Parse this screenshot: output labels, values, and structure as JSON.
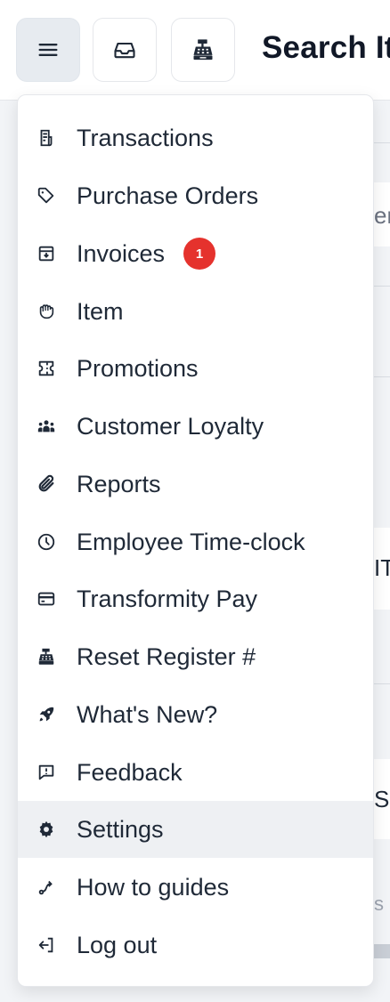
{
  "header": {
    "title": "Search It",
    "buttons": [
      {
        "icon": "menu-icon"
      },
      {
        "icon": "inbox-icon"
      },
      {
        "icon": "cash-register-icon"
      }
    ]
  },
  "background": {
    "fragments": [
      "er",
      "IT",
      "S",
      "s"
    ]
  },
  "menu": {
    "items": [
      {
        "label": "Transactions",
        "icon": "receipt-icon"
      },
      {
        "label": "Purchase Orders",
        "icon": "tag-icon"
      },
      {
        "label": "Invoices",
        "icon": "archive-icon",
        "badge": "1"
      },
      {
        "label": "Item",
        "icon": "hand-icon"
      },
      {
        "label": "Promotions",
        "icon": "ticket-icon"
      },
      {
        "label": "Customer Loyalty",
        "icon": "users-icon"
      },
      {
        "label": "Reports",
        "icon": "paperclip-icon"
      },
      {
        "label": "Employee Time-clock",
        "icon": "clock-icon"
      },
      {
        "label": "Transformity Pay",
        "icon": "credit-card-icon"
      },
      {
        "label": "Reset Register #",
        "icon": "cash-register-icon"
      },
      {
        "label": "What's New?",
        "icon": "rocket-icon"
      },
      {
        "label": "Feedback",
        "icon": "feedback-icon"
      },
      {
        "label": "Settings",
        "icon": "gear-icon",
        "active": true
      },
      {
        "label": "How to guides",
        "icon": "route-icon"
      },
      {
        "label": "Log out",
        "icon": "logout-icon"
      }
    ]
  },
  "colors": {
    "badge": "#e5322d",
    "active_row": "#eef0f3",
    "active_button": "#e7ebf0"
  }
}
